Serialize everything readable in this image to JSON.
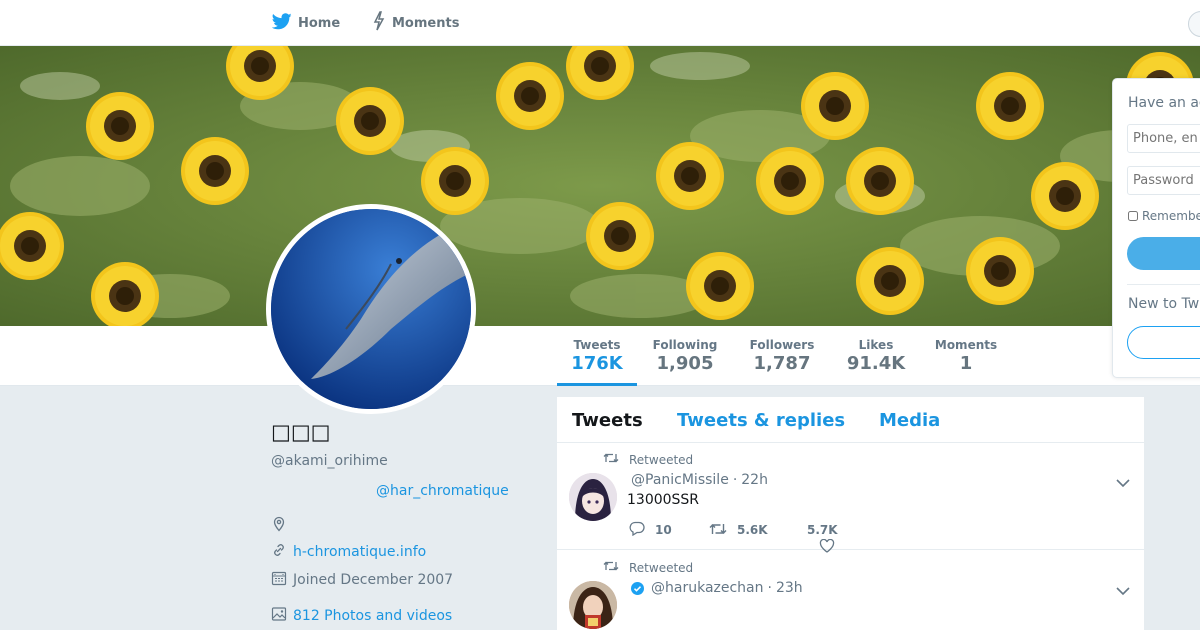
{
  "nav": {
    "home_label": "Home",
    "moments_label": "Moments"
  },
  "profile": {
    "display_name": "□□□",
    "handle": "@akami_orihime",
    "bio_mention": "@har_chromatique",
    "website": "h-chromatique.info",
    "joined": "Joined December 2007",
    "photos": "812 Photos and videos"
  },
  "stats": [
    {
      "label": "Tweets",
      "value": "176K"
    },
    {
      "label": "Following",
      "value": "1,905"
    },
    {
      "label": "Followers",
      "value": "1,787"
    },
    {
      "label": "Likes",
      "value": "91.4K"
    },
    {
      "label": "Moments",
      "value": "1"
    }
  ],
  "timeline": {
    "tabs": [
      "Tweets",
      "Tweets & replies",
      "Media"
    ],
    "tweets": [
      {
        "context": "Retweeted",
        "author": "@PanicMissile",
        "separator": "·",
        "time": "22h",
        "text": "13000SSR",
        "replies": "10",
        "retweets": "5.6K",
        "likes": "5.7K"
      },
      {
        "context": "Retweeted",
        "author": "@harukazechan",
        "separator": "·",
        "time": "23h",
        "verified": true
      }
    ]
  },
  "login": {
    "title": "Have an ac",
    "phone_placeholder": "Phone, en",
    "password_placeholder": "Password",
    "remember": "Remembe",
    "new_to": "New to Twi"
  },
  "colors": {
    "accent": "#1b95e0",
    "banner_green": "#6f8a3c",
    "sky_blue": "#0a3f9a"
  },
  "icons": {
    "brand": "twitter-bird-icon",
    "moments": "lightning-icon",
    "location": "location-pin-icon",
    "link": "link-icon",
    "calendar": "calendar-icon",
    "photo": "photo-icon",
    "retweet": "retweet-icon",
    "reply": "reply-icon",
    "like": "heart-icon",
    "caret": "chevron-down-icon"
  }
}
